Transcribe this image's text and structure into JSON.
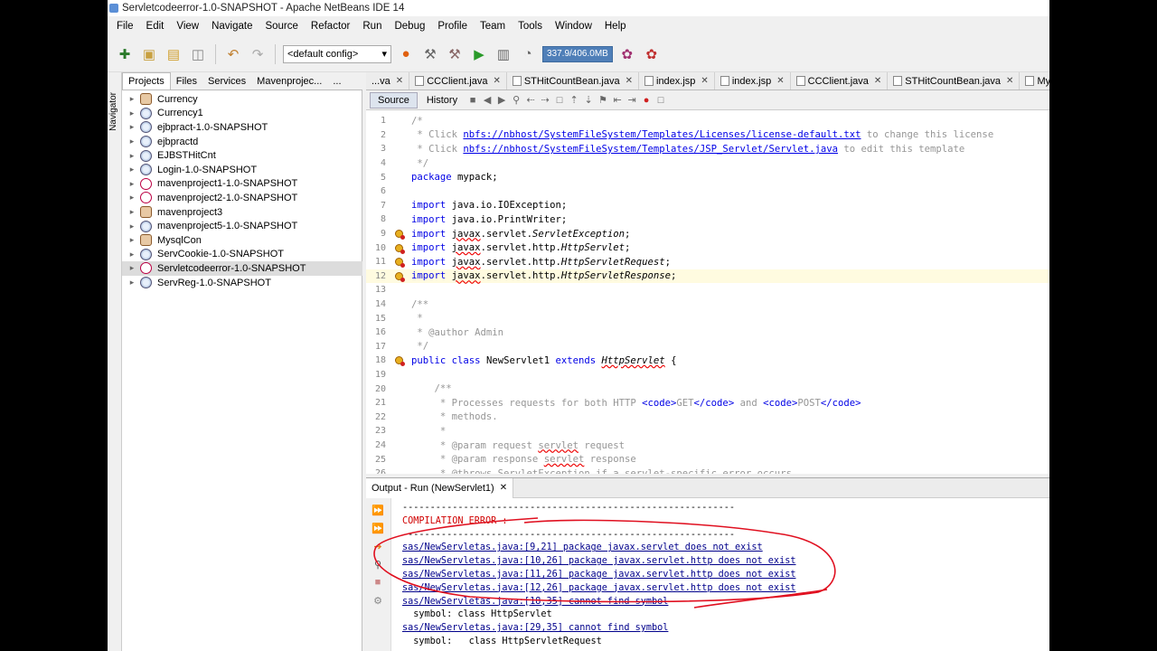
{
  "window": {
    "title": "Servletcodeerror-1.0-SNAPSHOT - Apache NetBeans IDE 14"
  },
  "menu": [
    "File",
    "Edit",
    "View",
    "Navigate",
    "Source",
    "Refactor",
    "Run",
    "Debug",
    "Profile",
    "Team",
    "Tools",
    "Window",
    "Help"
  ],
  "toolbar": {
    "config": "<default config>",
    "memory": "337.9/406.0MB"
  },
  "left_panel": {
    "navigator_label": "Navigator",
    "tabs": [
      "Projects",
      "Files",
      "Services",
      "Mavenprojec...",
      "..."
    ],
    "projects": [
      {
        "name": "Currency",
        "icon": "cup"
      },
      {
        "name": "Currency1",
        "icon": "web"
      },
      {
        "name": "ejbpract-1.0-SNAPSHOT",
        "icon": "web"
      },
      {
        "name": "ejbpractd",
        "icon": "web"
      },
      {
        "name": "EJBSTHitCnt",
        "icon": "web"
      },
      {
        "name": "Login-1.0-SNAPSHOT",
        "icon": "web"
      },
      {
        "name": "mavenproject1-1.0-SNAPSHOT",
        "icon": "mvn"
      },
      {
        "name": "mavenproject2-1.0-SNAPSHOT",
        "icon": "mvn"
      },
      {
        "name": "mavenproject3",
        "icon": "cup"
      },
      {
        "name": "mavenproject5-1.0-SNAPSHOT",
        "icon": "web"
      },
      {
        "name": "MysqlCon",
        "icon": "cup"
      },
      {
        "name": "ServCookie-1.0-SNAPSHOT",
        "icon": "web"
      },
      {
        "name": "Servletcodeerror-1.0-SNAPSHOT",
        "icon": "mvn",
        "selected": true
      },
      {
        "name": "ServReg-1.0-SNAPSHOT",
        "icon": "web"
      }
    ]
  },
  "editor": {
    "tabs": [
      "...va",
      "CCClient.java",
      "STHitCountBean.java",
      "index.jsp",
      "index.jsp",
      "CCClient.java",
      "STHitCountBean.java",
      "MysqlCon..."
    ],
    "source_label": "Source",
    "history_label": "History",
    "lines": [
      {
        "n": "1",
        "t": "/*"
      },
      {
        "n": "2",
        "t": " * Click nbfs://nbhost/SystemFileSystem/Templates/Licenses/license-default.txt to change this license"
      },
      {
        "n": "3",
        "t": " * Click nbfs://nbhost/SystemFileSystem/Templates/JSP_Servlet/Servlet.java to edit this template"
      },
      {
        "n": "4",
        "t": " */"
      },
      {
        "n": "5",
        "t": "package mypack;"
      },
      {
        "n": "6",
        "t": ""
      },
      {
        "n": "7",
        "t": "import java.io.IOException;"
      },
      {
        "n": "8",
        "t": "import java.io.PrintWriter;"
      },
      {
        "n": "9",
        "t": "import javax.servlet.ServletException;"
      },
      {
        "n": "10",
        "t": "import javax.servlet.http.HttpServlet;"
      },
      {
        "n": "11",
        "t": "import javax.servlet.http.HttpServletRequest;"
      },
      {
        "n": "12",
        "t": "import javax.servlet.http.HttpServletResponse;"
      },
      {
        "n": "13",
        "t": ""
      },
      {
        "n": "14",
        "t": "/**"
      },
      {
        "n": "15",
        "t": " *"
      },
      {
        "n": "16",
        "t": " * @author Admin"
      },
      {
        "n": "17",
        "t": " */"
      },
      {
        "n": "18",
        "t": "public class NewServlet1 extends HttpServlet {"
      },
      {
        "n": "19",
        "t": ""
      },
      {
        "n": "20",
        "t": "    /**"
      },
      {
        "n": "21",
        "t": "     * Processes requests for both HTTP <code>GET</code> and <code>POST</code>"
      },
      {
        "n": "22",
        "t": "     * methods."
      },
      {
        "n": "23",
        "t": "     *"
      },
      {
        "n": "24",
        "t": "     * @param request servlet request"
      },
      {
        "n": "25",
        "t": "     * @param response servlet response"
      },
      {
        "n": "26",
        "t": "     * @throws ServletException if a servlet-specific error occurs"
      }
    ]
  },
  "output": {
    "tab_label": "Output - Run (NewServlet1)",
    "lines": [
      {
        "t": "------------------------------------------------------------",
        "k": "plain"
      },
      {
        "t": "COMPILATION ERROR :",
        "k": "red"
      },
      {
        "t": "------------------------------------------------------------",
        "k": "plain"
      },
      {
        "t": "sas/NewServletas.java:[9,21] package javax.servlet does not exist",
        "k": "link"
      },
      {
        "t": "sas/NewServletas.java:[10,26] package javax.servlet.http does not exist",
        "k": "link"
      },
      {
        "t": "sas/NewServletas.java:[11,26] package javax.servlet.http does not exist",
        "k": "link"
      },
      {
        "t": "sas/NewServletas.java:[12,26] package javax.servlet.http does not exist",
        "k": "link"
      },
      {
        "t": "sas/NewServletas.java:[18,35] cannot find symbol",
        "k": "link"
      },
      {
        "t": "  symbol: class HttpServlet",
        "k": "plain"
      },
      {
        "t": "sas/NewServletas.java:[29,35] cannot find symbol",
        "k": "link"
      },
      {
        "t": "  symbol:   class HttpServletRequest",
        "k": "plain"
      }
    ]
  },
  "colors": {
    "accent": "#4f7fb8",
    "annotation": "#e01020",
    "link": "#00008b",
    "keyword": "#0000e6",
    "comment": "#969696"
  }
}
